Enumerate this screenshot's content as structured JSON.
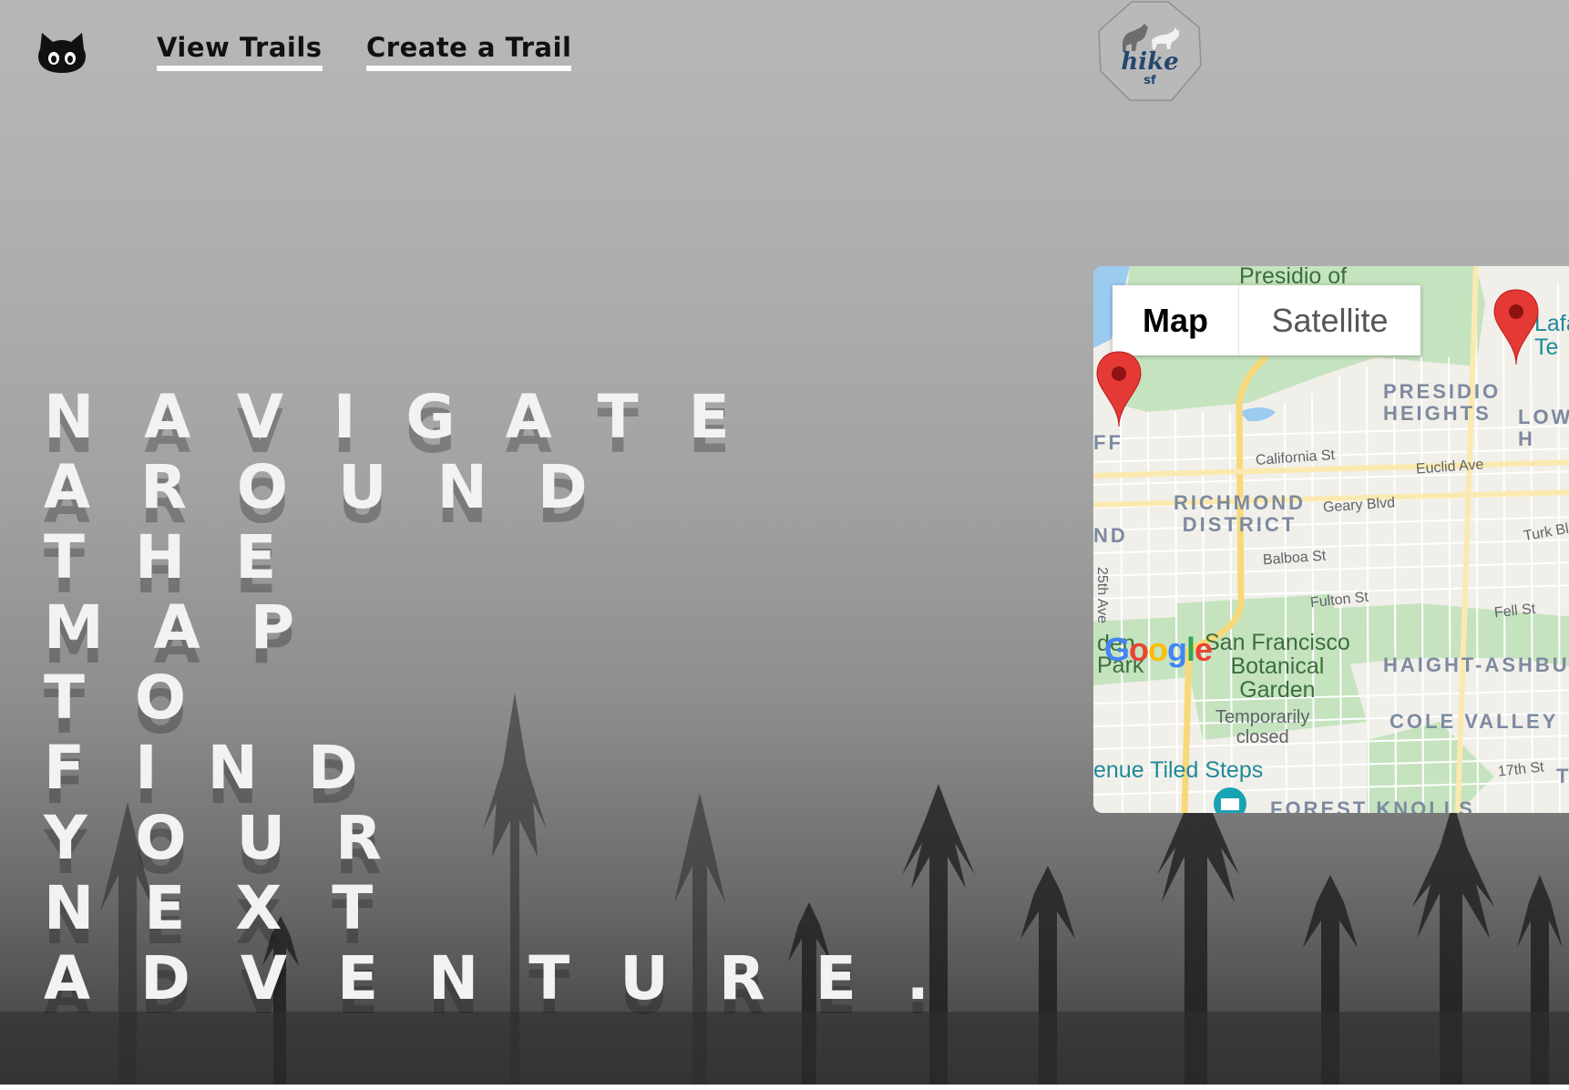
{
  "nav": {
    "github_icon": "github-octocat-icon",
    "links": [
      {
        "label": "View Trails"
      },
      {
        "label": "Create a Trail"
      }
    ],
    "logo": {
      "line1": "hike",
      "line2": "sf"
    }
  },
  "headline": {
    "lines": [
      "NAVIGATE",
      "AROUND",
      "THE",
      "MAP",
      "TO",
      "FIND",
      "YOUR",
      "NEXT",
      "ADVENTURE."
    ]
  },
  "map": {
    "map_button": "Map",
    "satellite_button": "Satellite",
    "labels": {
      "presidio_of": "Presidio of",
      "presidio_heights": "PRESIDIO\nHEIGHTS",
      "richmond": "RICHMOND\nDISTRICT",
      "haight": "HAIGHT-ASHBU",
      "cole_valley": "COLE VALLEY",
      "forest_knolls": "FOREST KNOLLS",
      "lafa": "Lafa\nTe",
      "low": "LOW\nH",
      "california": "California St",
      "euclid": "Euclid Ave",
      "geary": "Geary Blvd",
      "turk": "Turk Bl",
      "balboa": "Balboa St",
      "fulton": "Fulton St",
      "fell": "Fell St",
      "seventeenth": "17th St",
      "twentyfifth": "25th Ave",
      "botanical": "San Francisco\nBotanical\nGarden",
      "temporarily": "Temporarily\nclosed",
      "tiled_steps": "enue Tiled Steps",
      "park": "den\nPark",
      "nd": "ND",
      "ff": "FF",
      "t": "T",
      "google": "Google"
    },
    "marker_icon": "map-pin-icon",
    "colors": {
      "marker": "#e53935",
      "park": "#c8e6c0",
      "road": "#f7d97a"
    }
  }
}
